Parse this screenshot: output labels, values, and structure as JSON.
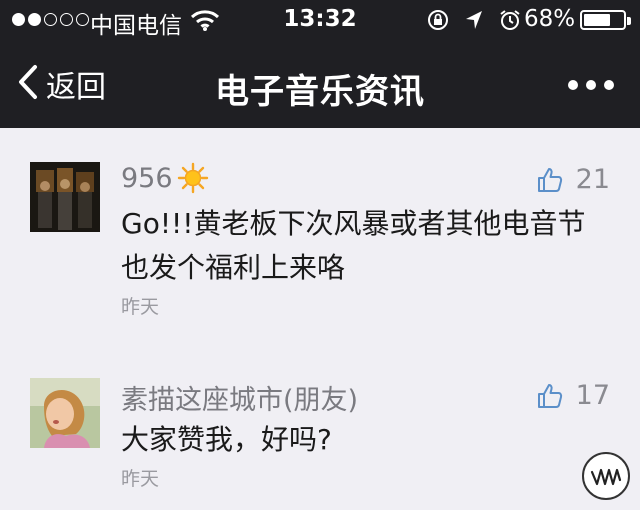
{
  "status_bar": {
    "carrier": "中国电信",
    "time": "13:32",
    "battery_percent": "68%",
    "battery_level": 0.68
  },
  "nav": {
    "back_label": "返回",
    "title": "电子音乐资讯",
    "more_icon": "more-dots-icon"
  },
  "comments": [
    {
      "username": "956",
      "badge_icon": "sun-icon",
      "likes": "21",
      "text_line1": "Go!!!黄老板下次风暴或者其他电音节",
      "text_line2": "也发个福利上来咯",
      "date": "昨天"
    },
    {
      "username": "素描这座城市(朋友)",
      "likes": "17",
      "text": "大家赞我，好吗?",
      "date": "昨天"
    }
  ],
  "colors": {
    "topbar": "#1f1f23",
    "background": "#f0eff4",
    "username": "#7a7a80",
    "like": "#8a8a90"
  }
}
